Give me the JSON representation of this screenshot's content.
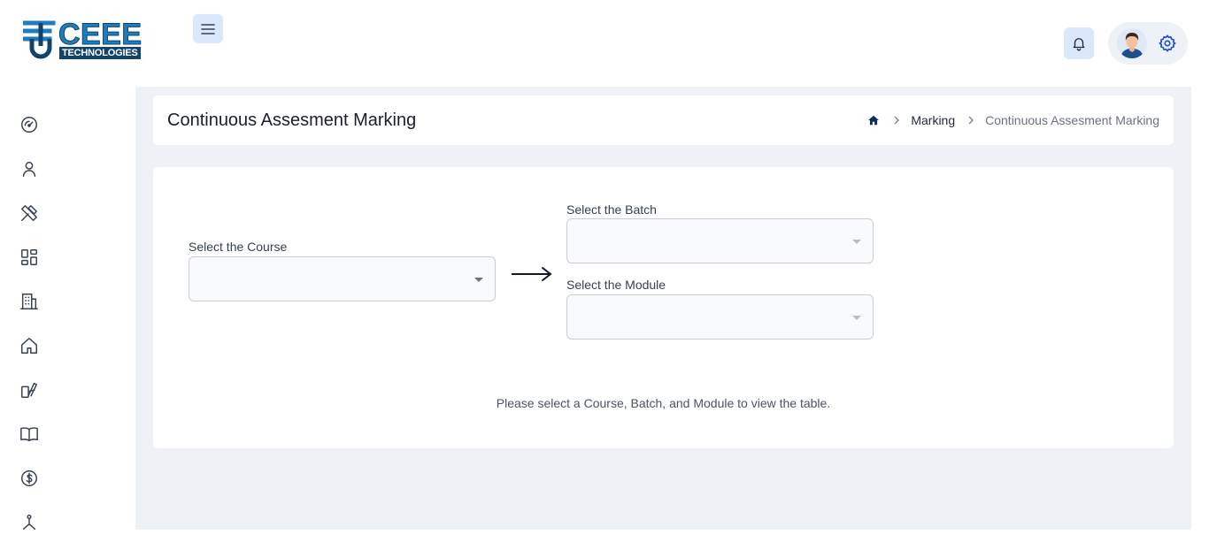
{
  "brand": {
    "name": "CEEE",
    "subtitle": "TECHNOLOGIES",
    "colors": {
      "blue": "#1f7dbf",
      "navy": "#12436b"
    }
  },
  "header": {
    "menu_icon": "hamburger-menu-icon",
    "notification_icon": "bell-icon",
    "settings_icon": "gear-icon"
  },
  "sidebar": {
    "items": [
      {
        "icon": "dashboard-gauge-icon"
      },
      {
        "icon": "user-icon"
      },
      {
        "icon": "tools-icon"
      },
      {
        "icon": "grid-layout-icon"
      },
      {
        "icon": "building-icon"
      },
      {
        "icon": "home-icon"
      },
      {
        "icon": "swatches-icon"
      },
      {
        "icon": "book-open-icon"
      },
      {
        "icon": "dollar-circle-icon"
      },
      {
        "icon": "network-icon"
      }
    ]
  },
  "page": {
    "title": "Continuous Assesment Marking",
    "breadcrumb": {
      "home_icon": "home-icon",
      "items": [
        "Marking",
        "Continuous Assesment Marking"
      ]
    }
  },
  "form": {
    "course_label": "Select the Course",
    "course_value": "",
    "batch_label": "Select the Batch",
    "batch_value": "",
    "module_label": "Select the Module",
    "module_value": "",
    "arrow_icon": "arrow-right-icon"
  },
  "empty_message": "Please select a Course, Batch, and Module to view the table."
}
